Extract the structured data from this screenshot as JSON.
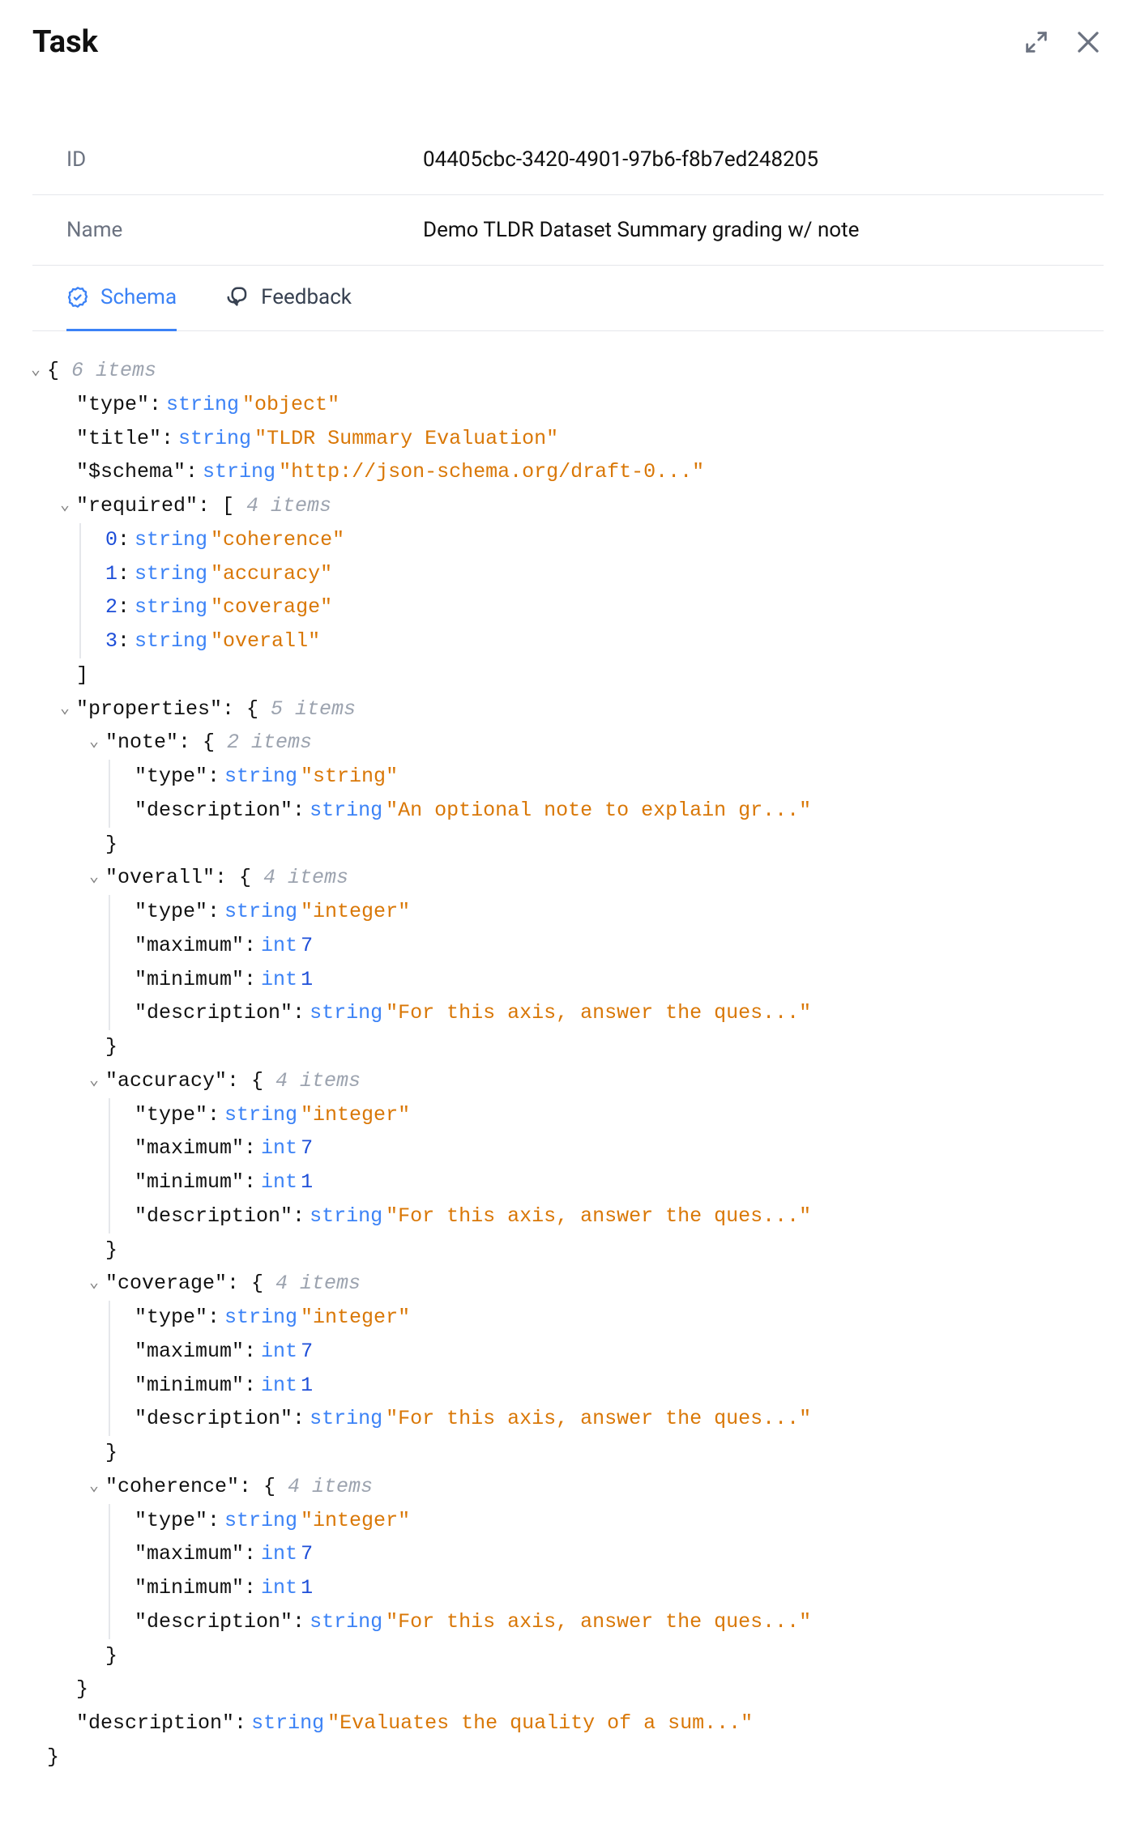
{
  "header": {
    "title": "Task"
  },
  "info": {
    "id_label": "ID",
    "id_value": "04405cbc-3420-4901-97b6-f8b7ed248205",
    "name_label": "Name",
    "name_value": "Demo TLDR Dataset Summary grading w/ note"
  },
  "tabs": {
    "schema": "Schema",
    "feedback": "Feedback"
  },
  "schema": {
    "root_count": "6 items",
    "type": {
      "key": "\"type\"",
      "typ": "string",
      "val": "\"object\""
    },
    "title": {
      "key": "\"title\"",
      "typ": "string",
      "val": "\"TLDR Summary Evaluation\""
    },
    "schema_key": {
      "key": "\"$schema\"",
      "typ": "string",
      "val": "\"http://json-schema.org/draft-0...\""
    },
    "required": {
      "key": "\"required\"",
      "count": "4 items",
      "items": [
        {
          "idx": "0",
          "typ": "string",
          "val": "\"coherence\""
        },
        {
          "idx": "1",
          "typ": "string",
          "val": "\"accuracy\""
        },
        {
          "idx": "2",
          "typ": "string",
          "val": "\"coverage\""
        },
        {
          "idx": "3",
          "typ": "string",
          "val": "\"overall\""
        }
      ]
    },
    "properties": {
      "key": "\"properties\"",
      "count": "5 items",
      "note": {
        "key": "\"note\"",
        "count": "2 items",
        "type": {
          "key": "\"type\"",
          "typ": "string",
          "val": "\"string\""
        },
        "desc": {
          "key": "\"description\"",
          "typ": "string",
          "val": "\"An optional note to explain gr...\""
        }
      },
      "overall": {
        "key": "\"overall\"",
        "count": "4 items",
        "type": {
          "key": "\"type\"",
          "typ": "string",
          "val": "\"integer\""
        },
        "max": {
          "key": "\"maximum\"",
          "typ": "int",
          "val": "7"
        },
        "min": {
          "key": "\"minimum\"",
          "typ": "int",
          "val": "1"
        },
        "desc": {
          "key": "\"description\"",
          "typ": "string",
          "val": "\"For this axis, answer the ques...\""
        }
      },
      "accuracy": {
        "key": "\"accuracy\"",
        "count": "4 items",
        "type": {
          "key": "\"type\"",
          "typ": "string",
          "val": "\"integer\""
        },
        "max": {
          "key": "\"maximum\"",
          "typ": "int",
          "val": "7"
        },
        "min": {
          "key": "\"minimum\"",
          "typ": "int",
          "val": "1"
        },
        "desc": {
          "key": "\"description\"",
          "typ": "string",
          "val": "\"For this axis, answer the ques...\""
        }
      },
      "coverage": {
        "key": "\"coverage\"",
        "count": "4 items",
        "type": {
          "key": "\"type\"",
          "typ": "string",
          "val": "\"integer\""
        },
        "max": {
          "key": "\"maximum\"",
          "typ": "int",
          "val": "7"
        },
        "min": {
          "key": "\"minimum\"",
          "typ": "int",
          "val": "1"
        },
        "desc": {
          "key": "\"description\"",
          "typ": "string",
          "val": "\"For this axis, answer the ques...\""
        }
      },
      "coherence": {
        "key": "\"coherence\"",
        "count": "4 items",
        "type": {
          "key": "\"type\"",
          "typ": "string",
          "val": "\"integer\""
        },
        "max": {
          "key": "\"maximum\"",
          "typ": "int",
          "val": "7"
        },
        "min": {
          "key": "\"minimum\"",
          "typ": "int",
          "val": "1"
        },
        "desc": {
          "key": "\"description\"",
          "typ": "string",
          "val": "\"For this axis, answer the ques...\""
        }
      }
    },
    "description": {
      "key": "\"description\"",
      "typ": "string",
      "val": "\"Evaluates the quality of a sum...\""
    }
  }
}
